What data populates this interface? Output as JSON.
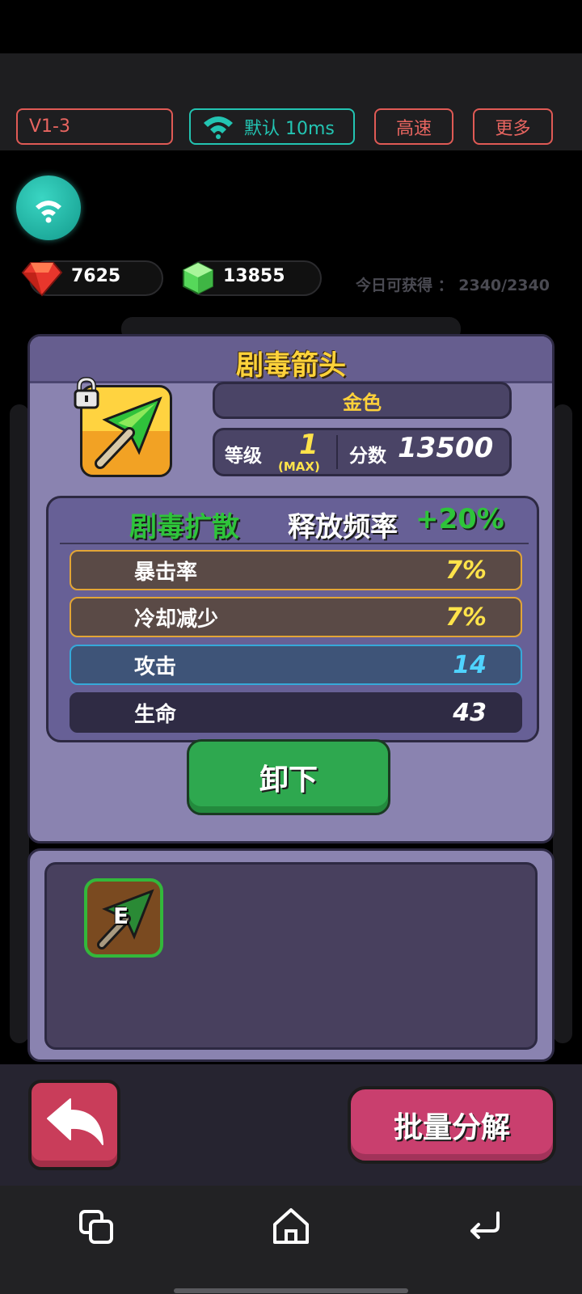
{
  "toolbar": {
    "level_label": "V1-3",
    "network_label": "默认 10ms",
    "speed_label": "高速",
    "more_label": "更多"
  },
  "currencies": {
    "gems": "7625",
    "cubes": "13855",
    "daily_label": "今日可获得 ：",
    "daily_value": "2340/2340"
  },
  "item": {
    "name": "剧毒箭头",
    "rarity": "金色",
    "level_label": "等级",
    "level_value": "1",
    "level_max": "(MAX)",
    "score_label": "分数",
    "score_value": "13500",
    "skill_name": "剧毒扩散",
    "skill_effect": "释放频率",
    "skill_bonus": "+20%",
    "stats": [
      {
        "label": "暴击率",
        "value": "7%"
      },
      {
        "label": "冷却减少",
        "value": "7%"
      },
      {
        "label": "攻击",
        "value": "14"
      },
      {
        "label": "生命",
        "value": "43"
      }
    ],
    "unequip_label": "卸下"
  },
  "inventory": {
    "items": [
      {
        "badge": "E"
      }
    ]
  },
  "bottom": {
    "batch_label": "批量分解"
  },
  "colors": {
    "title_gold": "#ffd23a",
    "skill_green": "#2ec43a",
    "stat_yellow": "#ffe34a",
    "stat_blue": "#4fd3ff"
  },
  "icons": [
    "wifi-icon",
    "red-gem-icon",
    "green-cube-icon",
    "lock-icon",
    "poison-arrow-icon",
    "back-arrow-icon",
    "recent-apps-icon",
    "home-icon",
    "back-nav-icon"
  ]
}
